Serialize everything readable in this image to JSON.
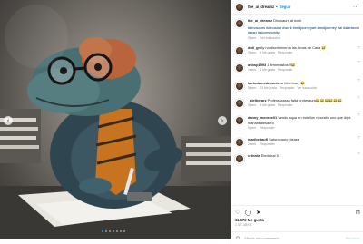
{
  "post": {
    "username": "the_ai_dreamz",
    "follow_label": "Seguir",
    "caption": "Dinosaurs at work",
    "hashtags": "#dinosaurs #dinosaur #work #midjourneyart #midjourney #ai #aiartwork #aiart #aicommunity",
    "caption_meta": [
      "5 sem.",
      "Ver traducción"
    ],
    "likes": "11.672 Me gusta",
    "date": "2 DE ABRIL",
    "add_comment_placeholder": "Añade un comentario...",
    "post_label": "Publicar"
  },
  "comments": [
    {
      "user": "didi_gr",
      "text": "Ay no discriminen a las Amas de Casa 😅",
      "meta": [
        "5 sem.",
        "9 Me gusta",
        "Responder"
      ]
    },
    {
      "user": "anbsp1993",
      "text": "1 fermedsitos!!!😂",
      "meta": [
        "1 sem.",
        "3 Me gusta",
        "Responder"
      ]
    },
    {
      "user": "kartodamedepontero",
      "text": "Veterinary 😂",
      "meta": [
        "5 sem.",
        "23 Me gusta",
        "Responder",
        "Ver traducción"
      ]
    },
    {
      "user": "_aletherarz",
      "text": "Professsssssa falta profesaura😂😂😂😂😂😂",
      "meta": [
        "5 sem.",
        "8 Me gusta",
        "Responder"
      ]
    },
    {
      "user": "danny_monroe01",
      "text": "Vendo aqua en botellón necesito uno que diga manantialesauro",
      "meta": [
        "5 sem.",
        "Responder"
      ]
    },
    {
      "user": "maribeltaufl",
      "text": "Saturosauro please",
      "meta": [
        "2 sem.",
        "Responder"
      ]
    },
    {
      "user": "crtezda",
      "text": "Electrical 5",
      "meta": []
    }
  ],
  "icons": [
    "more-icon",
    "heart-icon",
    "comment-icon",
    "share-icon",
    "bookmark-icon",
    "emoji-icon",
    "chevron-left-icon",
    "chevron-right-icon"
  ]
}
